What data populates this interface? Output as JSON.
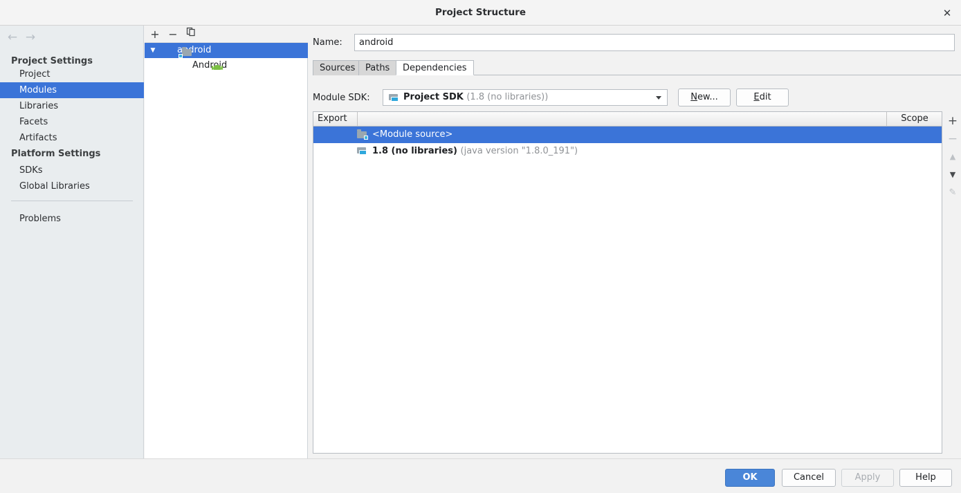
{
  "window": {
    "title": "Project Structure",
    "close_label": "✕"
  },
  "sidebar": {
    "back_icon": "←",
    "forward_icon": "→",
    "groups": [
      {
        "label": "Project Settings"
      },
      {
        "label": "Platform Settings"
      }
    ],
    "items": [
      {
        "label": "Project",
        "selected": false
      },
      {
        "label": "Modules",
        "selected": true
      },
      {
        "label": "Libraries",
        "selected": false
      },
      {
        "label": "Facets",
        "selected": false
      },
      {
        "label": "Artifacts",
        "selected": false
      },
      {
        "label": "SDKs",
        "selected": false
      },
      {
        "label": "Global Libraries",
        "selected": false
      },
      {
        "label": "Problems",
        "selected": false
      }
    ]
  },
  "tree_panel": {
    "toolbar": {
      "add_label": "+",
      "remove_label": "−",
      "copy_label": "⎘"
    },
    "nodes": [
      {
        "label": "android",
        "icon": "module-folder-icon",
        "expander": "▼",
        "selected": true
      },
      {
        "label": "Android",
        "icon": "android-robot-icon",
        "selected": false
      }
    ]
  },
  "detail": {
    "name_label": "Name:",
    "name_value": "android",
    "name_placeholder": "",
    "tabs": [
      {
        "label": "Sources",
        "active": false
      },
      {
        "label": "Paths",
        "active": false
      },
      {
        "label": "Dependencies",
        "active": true
      }
    ],
    "sdk": {
      "label": "Module SDK:",
      "value": "Project SDK",
      "value_detail": "(1.8 (no libraries))",
      "icon": "sdk-icon",
      "new_button": "New...",
      "new_button_mnemonic": "N",
      "edit_button": "Edit",
      "edit_button_mnemonic": "E"
    },
    "table": {
      "columns": [
        "Export",
        "",
        "Scope"
      ],
      "rows": [
        {
          "export_checked": false,
          "icon": "module-source-icon",
          "name": "<Module source>",
          "detail": "",
          "scope": "",
          "selected": true
        },
        {
          "export_checked": false,
          "icon": "sdk-icon",
          "name": "1.8 (no libraries)",
          "detail": "(java version \"1.8.0_191\")",
          "scope": "",
          "selected": false
        }
      ]
    },
    "side_toolbar": {
      "add": "+",
      "remove": "−",
      "move_up": "▲",
      "move_down": "▼",
      "edit": "✎"
    }
  },
  "footer": {
    "buttons": [
      {
        "label": "OK",
        "style": "primary"
      },
      {
        "label": "Cancel",
        "style": "normal"
      },
      {
        "label": "Apply",
        "style": "disabled"
      },
      {
        "label": "Help",
        "style": "normal"
      }
    ]
  },
  "colors": {
    "selection_blue": "#3b74d8",
    "primary_button": "#4a86d8",
    "sidebar_bg": "#e9edef",
    "panel_bg": "#f2f2f2",
    "android_green": "#7bc043",
    "sdk_cyan": "#2fa8dc"
  }
}
